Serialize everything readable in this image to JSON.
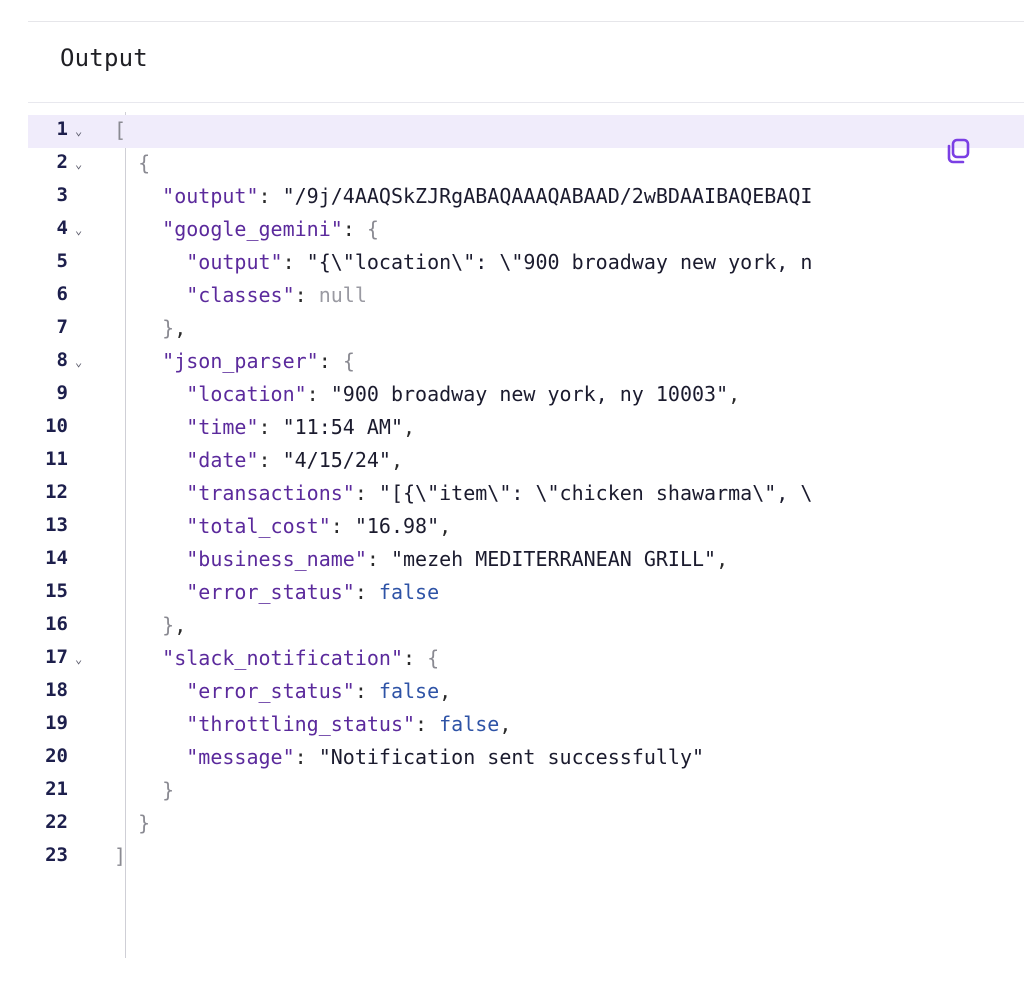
{
  "panel": {
    "title": "Output"
  },
  "icons": {
    "copy": "copy-icon",
    "fold": "chevron-down-icon"
  },
  "colors": {
    "key": "#5b2a9c",
    "boolean": "#2e53a6",
    "null": "#9a9aa2",
    "active_line": "#f0ecfb",
    "copy_icon": "#7b3fe4"
  },
  "editor": {
    "active_line": 1,
    "lines": [
      {
        "n": "1",
        "fold": true,
        "text": "["
      },
      {
        "n": "2",
        "fold": true,
        "text": "  {"
      },
      {
        "n": "3",
        "fold": false,
        "text": "    \"output\": \"/9j/4AAQSkZJRgABAQAAAQABAAD/2wBDAAIBAQEBAQI"
      },
      {
        "n": "4",
        "fold": true,
        "text": "    \"google_gemini\": {"
      },
      {
        "n": "5",
        "fold": false,
        "text": "      \"output\": \"{\\\"location\\\": \\\"900 broadway new york, n"
      },
      {
        "n": "6",
        "fold": false,
        "text": "      \"classes\": null"
      },
      {
        "n": "7",
        "fold": false,
        "text": "    },"
      },
      {
        "n": "8",
        "fold": true,
        "text": "    \"json_parser\": {"
      },
      {
        "n": "9",
        "fold": false,
        "text": "      \"location\": \"900 broadway new york, ny 10003\","
      },
      {
        "n": "10",
        "fold": false,
        "text": "      \"time\": \"11:54 AM\","
      },
      {
        "n": "11",
        "fold": false,
        "text": "      \"date\": \"4/15/24\","
      },
      {
        "n": "12",
        "fold": false,
        "text": "      \"transactions\": \"[{\\\"item\\\": \\\"chicken shawarma\\\", \\"
      },
      {
        "n": "13",
        "fold": false,
        "text": "      \"total_cost\": \"16.98\","
      },
      {
        "n": "14",
        "fold": false,
        "text": "      \"business_name\": \"mezeh MEDITERRANEAN GRILL\","
      },
      {
        "n": "15",
        "fold": false,
        "text": "      \"error_status\": false"
      },
      {
        "n": "16",
        "fold": false,
        "text": "    },"
      },
      {
        "n": "17",
        "fold": true,
        "text": "    \"slack_notification\": {"
      },
      {
        "n": "18",
        "fold": false,
        "text": "      \"error_status\": false,"
      },
      {
        "n": "19",
        "fold": false,
        "text": "      \"throttling_status\": false,"
      },
      {
        "n": "20",
        "fold": false,
        "text": "      \"message\": \"Notification sent successfully\""
      },
      {
        "n": "21",
        "fold": false,
        "text": "    }"
      },
      {
        "n": "22",
        "fold": false,
        "text": "  }"
      },
      {
        "n": "23",
        "fold": false,
        "text": "]"
      }
    ]
  }
}
